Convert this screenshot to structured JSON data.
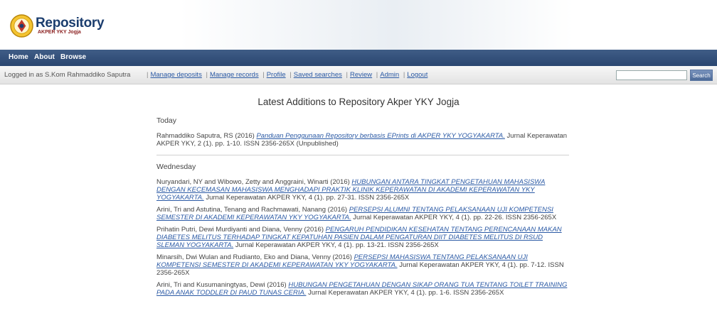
{
  "site": {
    "title": "Repository",
    "subtitle": "AKPER YKY Jogja"
  },
  "nav": [
    "Home",
    "About",
    "Browse"
  ],
  "userbar": {
    "logged_in": "Logged in as S.Kom Rahmaddiko Saputra",
    "links": [
      "Manage deposits",
      "Manage records",
      "Profile",
      "Saved searches",
      "Review",
      "Admin",
      "Logout"
    ],
    "search_placeholder": "",
    "search_button": "Search"
  },
  "page_title": "Latest Additions to Repository Akper YKY Jogja",
  "sections": [
    {
      "day": "Today",
      "items": [
        {
          "authors": "Rahmaddiko Saputra, RS (2016)",
          "title": "Panduan Penggunaan Repository berbasis EPrints di AKPER YKY YOGYAKARTA.",
          "rest": "Jurnal Keperawatan AKPER YKY, 2 (1). pp. 1-10. ISSN 2356-265X (Unpublished)"
        }
      ]
    },
    {
      "day": "Wednesday",
      "items": [
        {
          "authors": "Nuryandari, NY and Wibowo, Zetty and Anggraini, Winarti (2016)",
          "title": "HUBUNGAN ANTARA TINGKAT PENGETAHUAN MAHASISWA DENGAN KECEMASAN MAHASISWA MENGHADAPI PRAKTIK KLINIK KEPERAWATAN DI AKADEMI KEPERAWATAN YKY YOGYAKARTA.",
          "rest": "Jurnal Keperawatan AKPER YKY, 4 (1). pp. 27-31. ISSN 2356-265X"
        },
        {
          "authors": "Arini, Tri and Astutina, Tenang and Rachmawati, Nanang (2016)",
          "title": "PERSEPSI ALUMNI TENTANG PELAKSANAAN UJI KOMPETENSI SEMESTER DI AKADEMI KEPERAWATAN YKY YOGYAKARTA.",
          "rest": "Jurnal Keperawatan AKPER YKY, 4 (1). pp. 22-26. ISSN 2356-265X"
        },
        {
          "authors": "Prihatin Putri, Dewi Murdiyanti and Diana, Venny (2016)",
          "title": "PENGARUH PENDIDIKAN KESEHATAN TENTANG PERENCANAAN MAKAN DIABETES MELITUS TERHADAP TINGKAT KEPATUHAN PASIEN DALAM PENGATURAN DIIT DIABETES MELITUS DI RSUD SLEMAN YOGYAKARTA.",
          "rest": "Jurnal Keperawatan AKPER YKY, 4 (1). pp. 13-21. ISSN 2356-265X"
        },
        {
          "authors": "Minarsih, Dwi Wulan and Rudianto, Eko and Diana, Venny (2016)",
          "title": "PERSEPSI MAHASISWA TENTANG PELAKSANAAN UJI KOMPETENSI SEMESTER DI AKADEMI KEPERAWATAN YKY YOGYAKARTA.",
          "rest": "Jurnal Keperawatan AKPER YKY, 4 (1). pp. 7-12. ISSN 2356-265X"
        },
        {
          "authors": "Arini, Tri and Kusumaningtyas, Dewi (2016)",
          "title": "HUBUNGAN PENGETAHUAN DENGAN SIKAP ORANG TUA TENTANG TOILET TRAINING PADA ANAK TODDLER DI PAUD TUNAS CERIA.",
          "rest": "Jurnal Keperawatan AKPER YKY, 4 (1). pp. 1-6. ISSN 2356-265X"
        }
      ]
    }
  ]
}
